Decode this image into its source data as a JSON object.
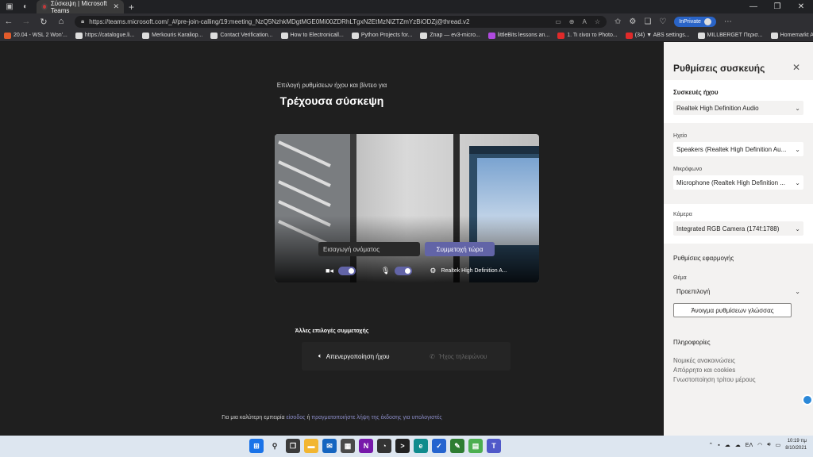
{
  "browser": {
    "tab_title": "Σύσκεψη | Microsoft Teams",
    "url": "https://teams.microsoft.com/_#/pre-join-calling/19:meeting_NzQ5NzhkMDgtMGE0Mi00ZDRhLTgxN2EtMzNlZTZmYzBiODZj@thread.v2",
    "profile_label": "InPrivate",
    "bookmarks": [
      {
        "label": "20.04 - WSL 2 Won'...",
        "color": "#e25b2b"
      },
      {
        "label": "https://catalogue.li...",
        "color": "#dddddd"
      },
      {
        "label": "Merkouris Karaliop...",
        "color": "#dddddd"
      },
      {
        "label": "Contact Verification...",
        "color": "#dddddd"
      },
      {
        "label": "How to Electronicall...",
        "color": "#dddddd"
      },
      {
        "label": "Python Projects for...",
        "color": "#dddddd"
      },
      {
        "label": "Znap — ev3-micro...",
        "color": "#dddddd"
      },
      {
        "label": "littleBits lessons an...",
        "color": "#b04ae0"
      },
      {
        "label": "1. Τι είναι το Photo...",
        "color": "#e02a2a"
      },
      {
        "label": "(34) ▼ ABS settings...",
        "color": "#e02a2a"
      },
      {
        "label": "MILLBERGET Περισ...",
        "color": "#dddddd"
      },
      {
        "label": "Homemarkt ANTAA...",
        "color": "#dddddd"
      }
    ]
  },
  "prejoin": {
    "subtitle": "Επιλογή ρυθμίσεων ήχου και βίντεο για",
    "meeting_title": "Τρέχουσα σύσκεψη",
    "name_placeholder": "Εισαγωγή ονόματος",
    "join_label": "Συμμετοχή τώρα",
    "audio_device_short": "Realtek High Definition A...",
    "other_options_title": "Άλλες επιλογές συμμετοχής",
    "audio_off_label": "Απενεργοποίηση ήχου",
    "phone_audio_label": "Ήχος τηλεφώνου",
    "footer_prefix": "Για μια καλύτερη εμπειρία ",
    "footer_signin": "είσοδος",
    "footer_middle": " ή ",
    "footer_download": "πραγματοποιήστε λήψη της έκδοσης για υπολογιστές",
    "camera_on": true,
    "mic_on": true
  },
  "settings": {
    "title": "Ρυθμίσεις συσκευής",
    "audio_devices_label": "Συσκευές ήχου",
    "audio_device": "Realtek High Definition Audio",
    "speaker_label": "Ηχείο",
    "speaker": "Speakers (Realtek High Definition Au...",
    "mic_label": "Μικρόφωνο",
    "mic": "Microphone (Realtek High Definition ...",
    "camera_label": "Κάμερα",
    "camera": "Integrated RGB Camera (174f:1788)",
    "app_settings_label": "Ρυθμίσεις εφαρμογής",
    "theme_label": "Θέμα",
    "theme": "Προεπιλογή",
    "language_button": "Άνοιγμα ρυθμίσεων γλώσσας",
    "info_label": "Πληροφορίες",
    "links": [
      "Νομικές ανακοινώσεις",
      "Απόρρητο και cookies",
      "Γνωστοποίηση τρίτου μέρους"
    ]
  },
  "taskbar": {
    "language": "ΕΛ",
    "time": "10:19 πμ",
    "date": "8/10/2021",
    "icons": [
      {
        "name": "windows-start-icon",
        "color": "#1a73e8",
        "glyph": "⊞"
      },
      {
        "name": "search-icon",
        "color": "#dde6f0",
        "glyph": "⚲"
      },
      {
        "name": "task-view-icon",
        "color": "#3b3b3b",
        "glyph": "❐"
      },
      {
        "name": "file-explorer-icon",
        "color": "#f2b632",
        "glyph": "▬"
      },
      {
        "name": "mail-icon",
        "color": "#1565c0",
        "glyph": "✉"
      },
      {
        "name": "store-icon",
        "color": "#4a4a4a",
        "glyph": "▦"
      },
      {
        "name": "onenote-icon",
        "color": "#7719aa",
        "glyph": "N"
      },
      {
        "name": "clock-icon",
        "color": "#333333",
        "glyph": "◔"
      },
      {
        "name": "terminal-icon",
        "color": "#222222",
        "glyph": ">"
      },
      {
        "name": "edge-icon",
        "color": "#0f8b8d",
        "glyph": "e"
      },
      {
        "name": "todo-icon",
        "color": "#2564cf",
        "glyph": "✓"
      },
      {
        "name": "tool-icon",
        "color": "#2e7d32",
        "glyph": "✎"
      },
      {
        "name": "notepad-icon",
        "color": "#4caf50",
        "glyph": "▤"
      },
      {
        "name": "teams-icon",
        "color": "#5059c9",
        "glyph": "T"
      }
    ]
  }
}
